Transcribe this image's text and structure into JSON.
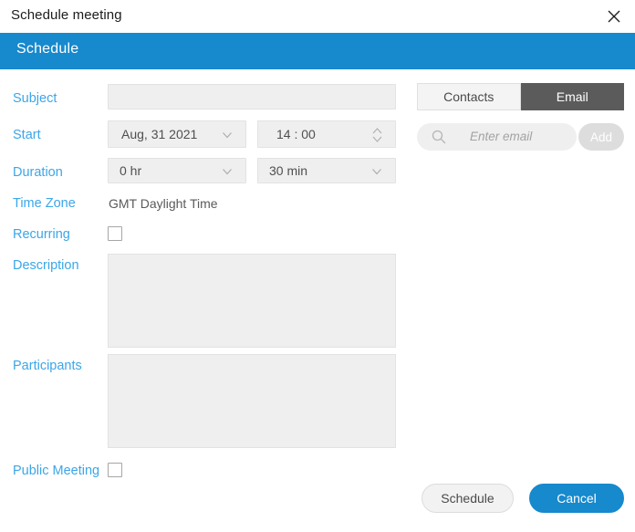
{
  "window": {
    "title": "Schedule meeting",
    "close_icon": "close-icon"
  },
  "header": {
    "title": "Schedule",
    "accent_color": "#1789cd"
  },
  "form": {
    "label_color": "#3ba6e8",
    "subject": {
      "label": "Subject",
      "value": "",
      "placeholder": ""
    },
    "start": {
      "label": "Start",
      "date_value": "Aug, 31 2021",
      "time_value": "14 :  00",
      "date_chevron_icon": "chevron-down-icon",
      "time_spinner_icon": "spinner-up-down-icon"
    },
    "duration": {
      "label": "Duration",
      "hours_value": "0   hr",
      "minutes_value": "30   min",
      "hours_chevron_icon": "chevron-down-icon",
      "minutes_chevron_icon": "chevron-down-icon"
    },
    "time_zone": {
      "label": "Time Zone",
      "value": "GMT Daylight Time"
    },
    "recurring": {
      "label": "Recurring",
      "checked": false
    },
    "description": {
      "label": "Description",
      "value": ""
    },
    "participants": {
      "label": "Participants",
      "value": ""
    },
    "public_meeting": {
      "label": "Public Meeting",
      "checked": false
    }
  },
  "invite_panel": {
    "tabs": [
      {
        "label": "Contacts",
        "active": false
      },
      {
        "label": "Email",
        "active": true
      }
    ],
    "search": {
      "icon": "search-icon",
      "placeholder": "Enter email",
      "value": ""
    },
    "add_button": {
      "label": "Add"
    }
  },
  "actions": {
    "schedule_label": "Schedule",
    "cancel_label": "Cancel",
    "cancel_color": "#1789cd"
  }
}
